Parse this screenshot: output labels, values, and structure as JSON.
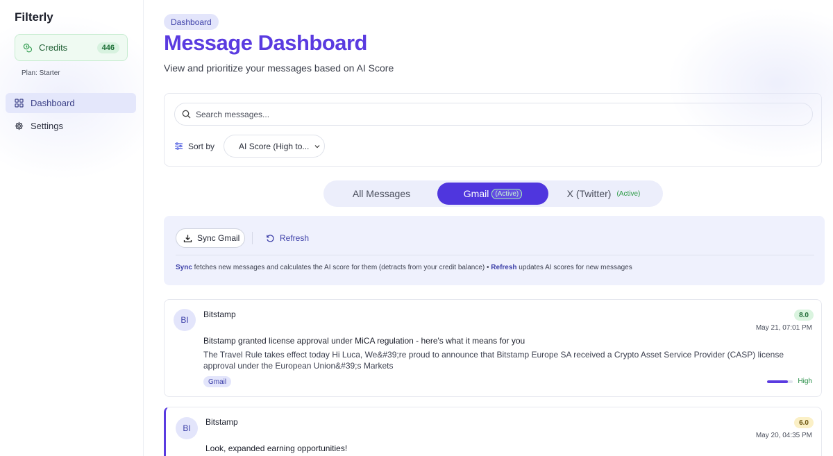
{
  "sidebar": {
    "brand": "Filterly",
    "credits_label": "Credits",
    "credits_count": "446",
    "plan": "Plan: Starter",
    "nav": [
      {
        "label": "Dashboard",
        "icon": "grid-icon"
      },
      {
        "label": "Settings",
        "icon": "gear-icon"
      }
    ]
  },
  "header": {
    "badge": "Dashboard",
    "title": "Message Dashboard",
    "subtitle": "View and prioritize your messages based on AI Score"
  },
  "filters": {
    "search_placeholder": "Search messages...",
    "sort_label": "Sort by",
    "sort_value": "AI Score (High to..."
  },
  "tabs": [
    {
      "label": "All Messages",
      "status": ""
    },
    {
      "label": "Gmail",
      "status": "(Active)"
    },
    {
      "label": "X (Twitter)",
      "status": "(Active)"
    }
  ],
  "sync": {
    "sync_label": "Sync Gmail",
    "refresh_label": "Refresh",
    "help_sync_word": "Sync",
    "help_sync_text": " fetches new messages and calculates the AI score for them (detracts from your credit balance) • ",
    "help_refresh_word": "Refresh",
    "help_refresh_text": " updates AI scores for new messages"
  },
  "messages": [
    {
      "initials": "BI",
      "sender": "Bitstamp",
      "score": "8.0",
      "date": "May 21, 07:01 PM",
      "subject": "Bitstamp granted license approval under MiCA regulation - here's what it means for you",
      "preview": "The Travel Rule takes effect today Hi Luca, We&#39;re proud to announce that Bitstamp Europe SA received a Crypto Asset Service Provider (CASP) license approval under the European Union&#39;s Markets",
      "source": "Gmail",
      "priority": "High",
      "priority_fraction": 0.8
    },
    {
      "initials": "BI",
      "sender": "Bitstamp",
      "score": "6.0",
      "date": "May 20, 04:35 PM",
      "subject": "Look, expanded earning opportunities!"
    }
  ],
  "colors": {
    "accent": "#5a3be0",
    "score_high_bg": "#daf4df",
    "score_mid_bg": "#fbf0c6",
    "credits_bg": "#effaf2"
  }
}
